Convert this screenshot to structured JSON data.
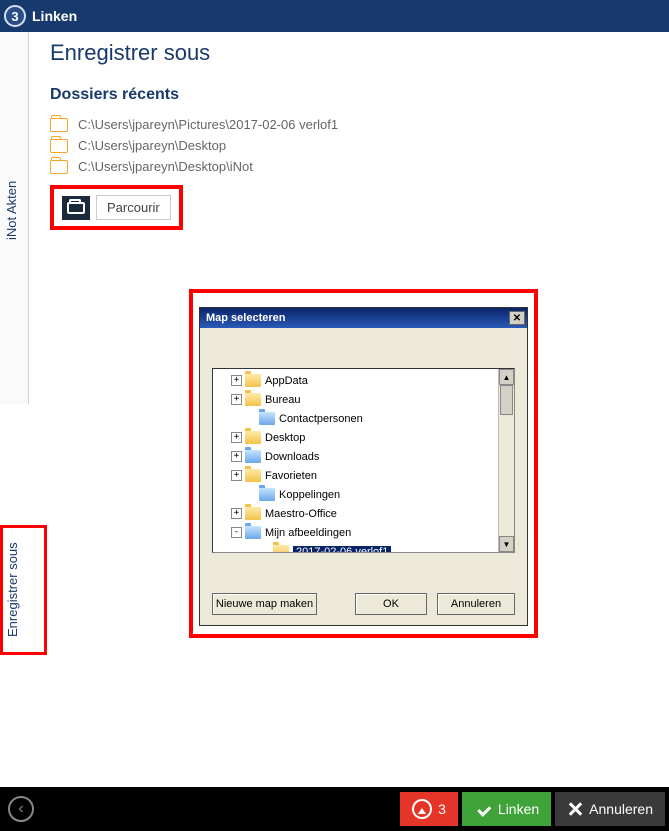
{
  "header": {
    "step": "3",
    "title": "Linken"
  },
  "sidebar": {
    "tab_inot": "iNot Akten",
    "tab_enregistrer": "Enregistrer sous"
  },
  "page": {
    "title": "Enregistrer sous",
    "section": "Dossiers récents",
    "recents": [
      "C:\\Users\\jpareyn\\Pictures\\2017-02-06 verlof1",
      "C:\\Users\\jpareyn\\Desktop",
      "C:\\Users\\jpareyn\\Desktop\\iNot"
    ],
    "browse": "Parcourir"
  },
  "dialog": {
    "title": "Map selecteren",
    "tree": [
      {
        "indent": 1,
        "expander": "+",
        "label": "AppData",
        "variant": ""
      },
      {
        "indent": 1,
        "expander": "+",
        "label": "Bureau",
        "variant": ""
      },
      {
        "indent": 2,
        "expander": "",
        "label": "Contactpersonen",
        "variant": "blue"
      },
      {
        "indent": 1,
        "expander": "+",
        "label": "Desktop",
        "variant": ""
      },
      {
        "indent": 1,
        "expander": "+",
        "label": "Downloads",
        "variant": "blue"
      },
      {
        "indent": 1,
        "expander": "+",
        "label": "Favorieten",
        "variant": ""
      },
      {
        "indent": 2,
        "expander": "",
        "label": "Koppelingen",
        "variant": "blue"
      },
      {
        "indent": 1,
        "expander": "+",
        "label": "Maestro-Office",
        "variant": ""
      },
      {
        "indent": 1,
        "expander": "-",
        "label": "Mijn afbeeldingen",
        "variant": "blue"
      },
      {
        "indent": 3,
        "expander": "",
        "label": "2017-02-06 verlof1",
        "variant": "",
        "selected": true
      }
    ],
    "btn_new": "Nieuwe map maken",
    "btn_ok": "OK",
    "btn_cancel": "Annuleren"
  },
  "footer": {
    "count": "3",
    "link": "Linken",
    "cancel": "Annuleren"
  }
}
